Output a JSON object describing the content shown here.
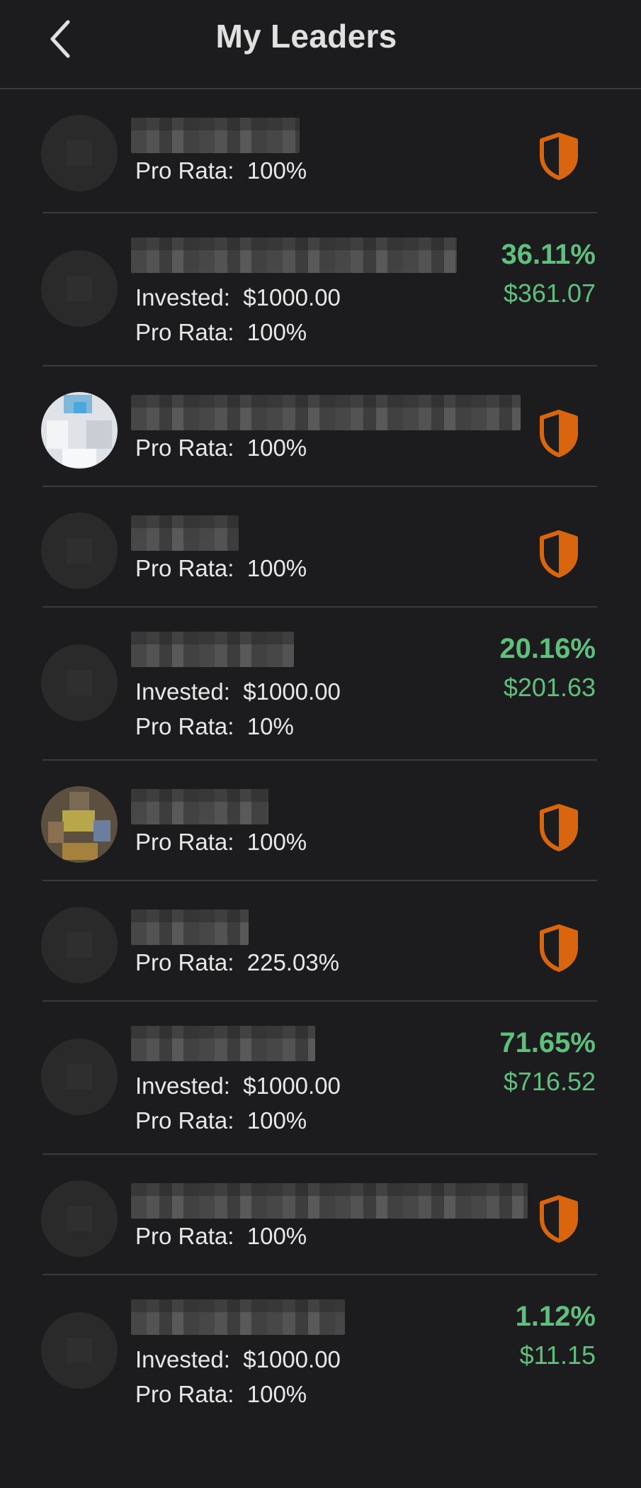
{
  "header": {
    "title": "My Leaders"
  },
  "labels": {
    "invested": "Invested:",
    "pro_rata": "Pro Rata:"
  },
  "leaders": [
    {
      "invested": null,
      "pro_rata": "100%",
      "return_pct": null,
      "return_amt": null,
      "protected": true
    },
    {
      "invested": "$1000.00",
      "pro_rata": "100%",
      "return_pct": "36.11%",
      "return_amt": "$361.07",
      "protected": false
    },
    {
      "invested": null,
      "pro_rata": "100%",
      "return_pct": null,
      "return_amt": null,
      "protected": true
    },
    {
      "invested": null,
      "pro_rata": "100%",
      "return_pct": null,
      "return_amt": null,
      "protected": true
    },
    {
      "invested": "$1000.00",
      "pro_rata": "10%",
      "return_pct": "20.16%",
      "return_amt": "$201.63",
      "protected": false
    },
    {
      "invested": null,
      "pro_rata": "100%",
      "return_pct": null,
      "return_amt": null,
      "protected": true
    },
    {
      "invested": null,
      "pro_rata": "225.03%",
      "return_pct": null,
      "return_amt": null,
      "protected": true
    },
    {
      "invested": "$1000.00",
      "pro_rata": "100%",
      "return_pct": "71.65%",
      "return_amt": "$716.52",
      "protected": false
    },
    {
      "invested": null,
      "pro_rata": "100%",
      "return_pct": null,
      "return_amt": null,
      "protected": true
    },
    {
      "invested": "$1000.00",
      "pro_rata": "100%",
      "return_pct": "1.12%",
      "return_amt": "$11.15",
      "protected": false
    }
  ],
  "colors": {
    "background": "#1c1c1e",
    "divider": "#3a3a3c",
    "positive": "#5fbf7d",
    "shield": "#d9650f"
  },
  "icons": {
    "back": "chevron-left-icon",
    "shield": "shield-icon"
  }
}
